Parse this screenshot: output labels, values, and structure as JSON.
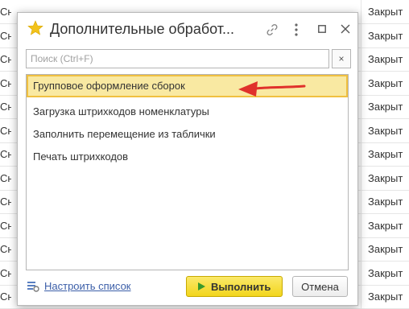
{
  "background": {
    "left_cells": [
      "Сн",
      "Сн",
      "Сн",
      "Сн",
      "Сн",
      "Сн",
      "Сн",
      "Сн",
      "Сн",
      "Сн",
      "Сн",
      "Сн",
      "Сн"
    ],
    "right_cells": [
      "Закрыт",
      "Закрыт",
      "Закрыт",
      "Закрыт",
      "Закрыт",
      "Закрыт",
      "Закрыт",
      "Закрыт",
      "Закрыт",
      "Закрыт",
      "Закрыт",
      "Закрыт",
      "Закрыт"
    ]
  },
  "dialog": {
    "title": "Дополнительные обработ...",
    "search": {
      "placeholder": "Поиск (Ctrl+F)",
      "value": "",
      "clear_label": "×"
    },
    "items": [
      {
        "label": "Групповое оформление сборок",
        "selected": true
      },
      {
        "label": "Загрузка штрихкодов номенклатуры",
        "selected": false
      },
      {
        "label": "Заполнить перемещение из таблички",
        "selected": false
      },
      {
        "label": "Печать штрихкодов",
        "selected": false
      }
    ],
    "footer": {
      "configure_label": "Настроить список",
      "run_label": "Выполнить",
      "cancel_label": "Отмена"
    }
  },
  "colors": {
    "accent_star": "#f2c21b",
    "selection_bg": "#f9e9a2",
    "selection_border": "#f0c040",
    "run_button": "#f2d51c",
    "annotation_arrow": "#e0312b",
    "link": "#3b5ea8"
  },
  "icons": {
    "title": "star-icon",
    "link": "link-icon",
    "menu": "more-vertical-icon",
    "maximize": "maximize-icon",
    "close": "close-icon",
    "configure": "settings-list-icon",
    "run": "play-icon"
  }
}
